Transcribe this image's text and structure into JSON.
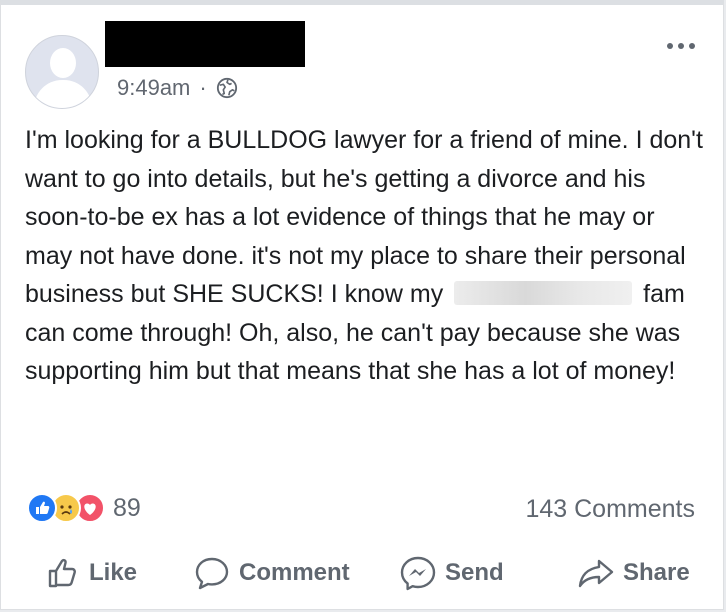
{
  "post": {
    "time": "9:49am",
    "separator": "·",
    "privacy_icon": "globe-icon",
    "text_parts": {
      "before_redaction": "I'm looking for a BULLDOG lawyer for a friend of mine. I don't want to go into details, but he's getting a divorce and his soon-to-be ex has a lot evidence of things that he may or may not have done. it's not my place to share their personal business but SHE SUCKS! I know my",
      "after_redaction": "fam can come through! Oh, also, he can't pay because she was supporting him but that means that she has a lot of money!"
    }
  },
  "reactions": {
    "icons": [
      "like-reaction-icon",
      "sad-reaction-icon",
      "love-reaction-icon"
    ],
    "count": "89",
    "comments": "143 Comments"
  },
  "actions": {
    "like": "Like",
    "comment": "Comment",
    "send": "Send",
    "share": "Share"
  },
  "colors": {
    "text": "#1c1e21",
    "secondary": "#606770",
    "like_blue": "#2078f4",
    "love_red": "#f25268",
    "sad_yellow": "#f7c94b"
  }
}
